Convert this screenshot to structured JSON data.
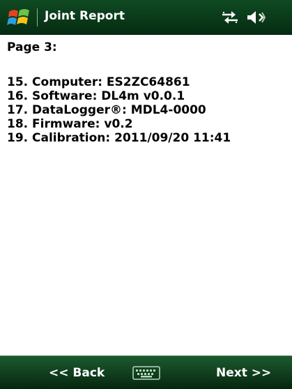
{
  "titlebar": {
    "title": "Joint Report",
    "start_icon": "windows-flag-icon",
    "status_icons": [
      "connectivity-icon",
      "speaker-muted-icon"
    ]
  },
  "content": {
    "page_label": "Page 3:",
    "items": [
      {
        "text": "15. Computer: ES2ZC64861"
      },
      {
        "text": "16. Software: DL4m v0.0.1"
      },
      {
        "text": "17. DataLogger®: MDL4-0000"
      },
      {
        "text": "18. Firmware: v0.2"
      },
      {
        "text": "19. Calibration: 2011/09/20 11:41"
      }
    ]
  },
  "softkeys": {
    "left_label": "<< Back",
    "right_label": "Next >>",
    "center_icon": "keyboard-icon"
  }
}
